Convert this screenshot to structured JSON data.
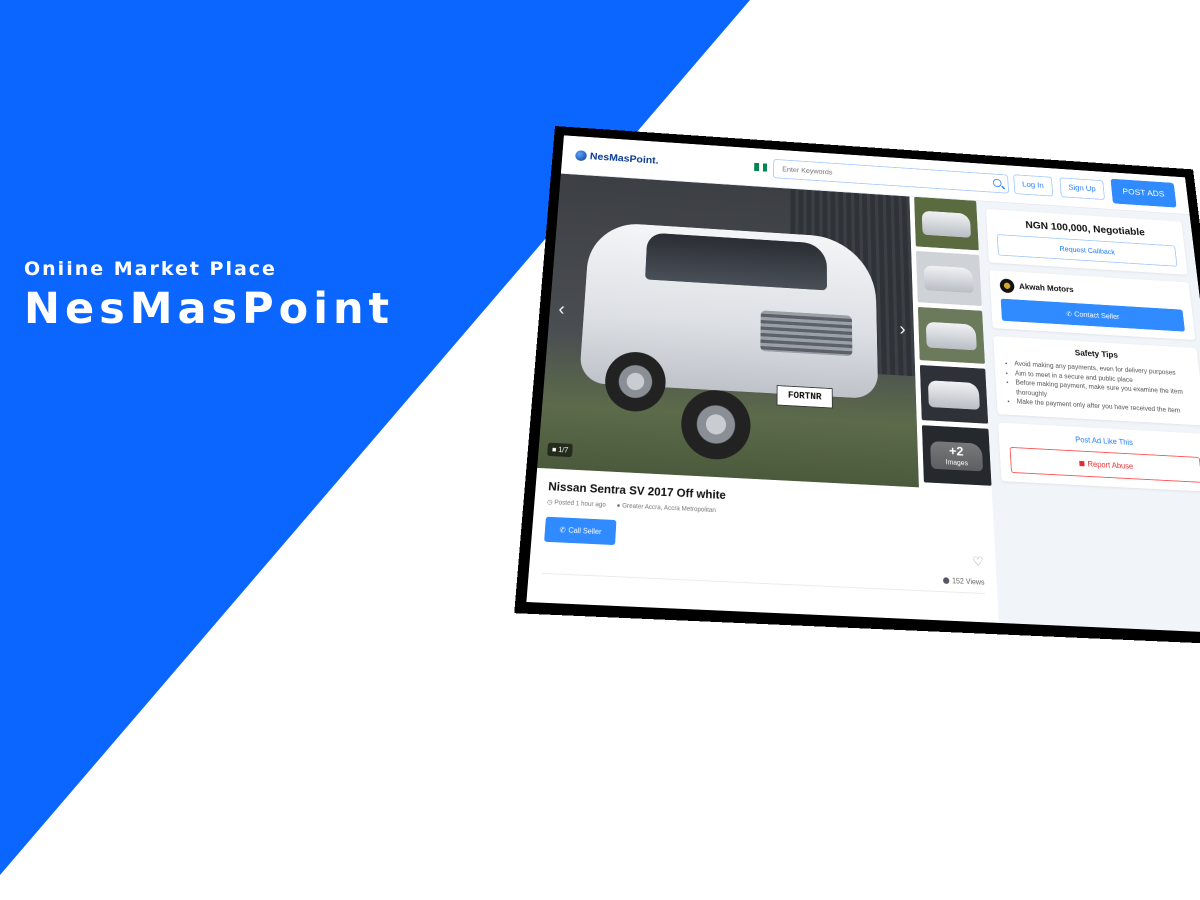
{
  "hero": {
    "subtitle": "Oniine Market Place",
    "title": "NesMasPoint"
  },
  "navbar": {
    "logo": "NesMasPoint.",
    "search_placeholder": "Enter Keywords",
    "login_label": "Log In",
    "signup_label": "Sign Up",
    "post_ads_label": "POST ADS"
  },
  "listing": {
    "photo_counter": "1/7",
    "plate_text": "FORTNR",
    "title": "Nissan Sentra SV 2017 Off white",
    "posted": "Posted 1 hour ago",
    "location": "Greater Accra, Accra Metropolitan",
    "call_seller_label": "Call Seller",
    "more_images_count": "+2",
    "more_images_label": "Images",
    "views": "152 Views"
  },
  "sidebar": {
    "price": "NGN 100,000, Negotiable",
    "request_callback_label": "Request Callback",
    "seller_name": "Akwah Motors",
    "contact_seller_label": "Contact Seller",
    "safety_title": "Safety Tips",
    "safety_tips": [
      "Avoid making any payments, even for delivery purposes",
      "Aim to meet in a secure and public place",
      "Before making payment, make sure you examine the item thoroughly",
      "Make the payment only after you have received the item"
    ],
    "post_ad_like_this": "Post Ad Like This",
    "report_abuse_label": "Report Abuse"
  },
  "colors": {
    "brand_blue": "#0a66ff",
    "primary_button": "#2f8bff",
    "danger": "#e62e30",
    "flag_green": "#008751",
    "flag_white": "#ffffff"
  }
}
